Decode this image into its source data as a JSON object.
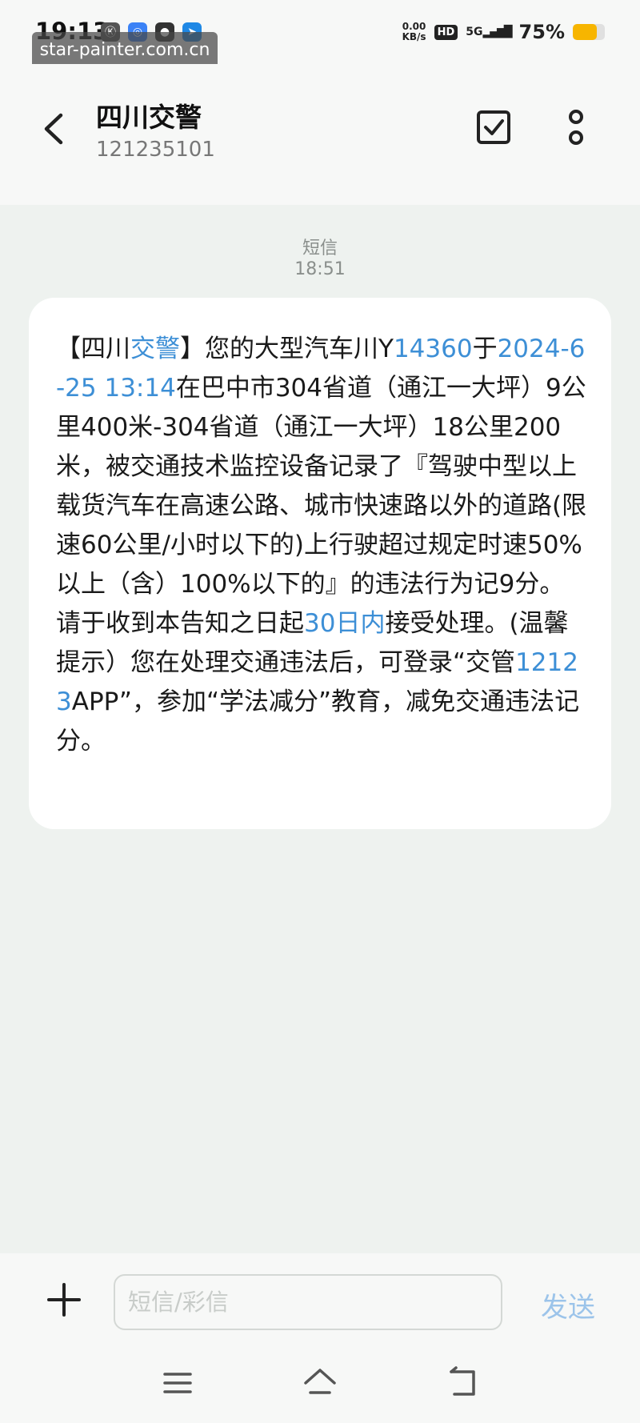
{
  "status_bar": {
    "time": "19:13",
    "net_speed_value": "0.00",
    "net_speed_unit": "KB/s",
    "hd_label": "HD",
    "signal_label": "5G",
    "battery_percent": "75%",
    "battery_level": 0.75,
    "battery_color": "#f7b500"
  },
  "watermark": "star-painter.com.cn",
  "header": {
    "contact_name": "四川交警",
    "contact_number": "121235101"
  },
  "message": {
    "type_label": "短信",
    "time": "18:51",
    "parts": {
      "p1": "【四川",
      "p2": "交警",
      "p3": "】您的大型汽车川Y",
      "p4": "14360",
      "p5": "于",
      "p6": "2024-6-25 13:14",
      "p7": "在巴中市304省道（通江一大坪）9公里400米-304省道（通江一大坪）18公里200米，被交通技术监控设备记录了『驾驶中型以上载货汽车在高速公路、城市快速路以外的道路(限速60公里/小时以下的)上行驶超过规定时速50%以上（含）100%以下的』的违法行为记9分。请于收到本告知之日起",
      "p8": "30日内",
      "p9": "接受处理。(温馨提示）您在处理交通违法后，可登录“交管",
      "p10": "12123",
      "p11": "APP”，参加“学法减分”教育，减免交通违法记分。"
    },
    "link_color": "#3d8fd6"
  },
  "input_bar": {
    "placeholder": "短信/彩信",
    "send_label": "发送"
  }
}
